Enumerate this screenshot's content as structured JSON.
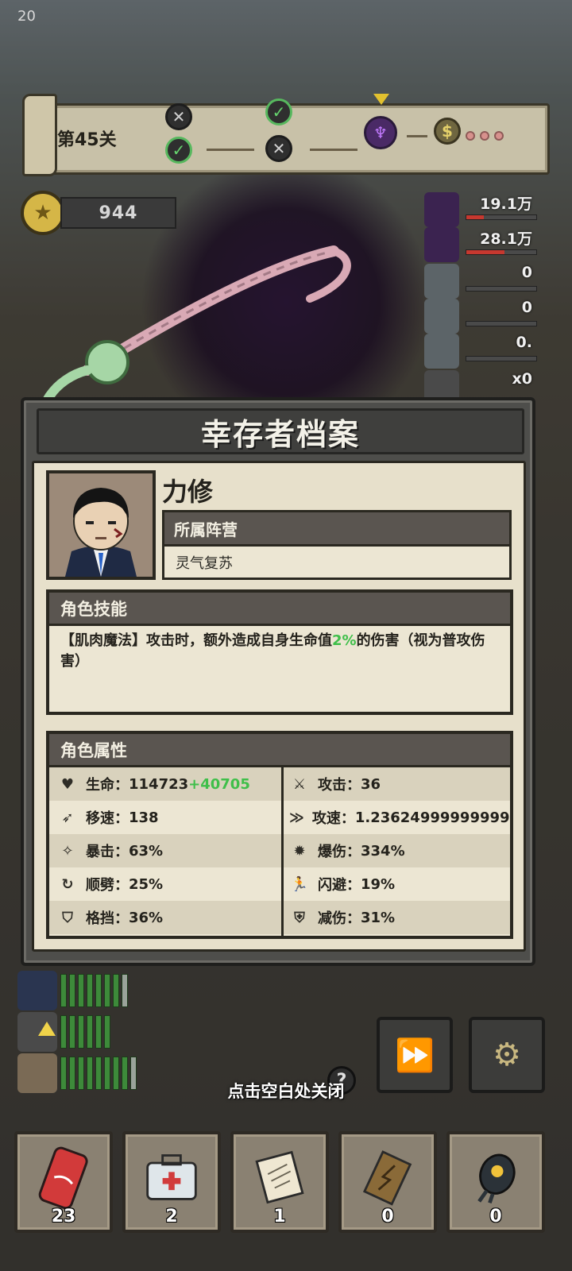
{
  "status": {
    "corner_number": "20"
  },
  "level": {
    "label": "第45关",
    "nodes": [
      {
        "icon": "crossed-swords-icon",
        "state": "done"
      },
      {
        "icon": "check-icon",
        "state": "done"
      },
      {
        "icon": "crossed-swords-icon",
        "state": "current"
      },
      {
        "icon": "check-icon",
        "state": "done"
      },
      {
        "icon": "boss-helmet-icon",
        "state": "boss"
      },
      {
        "icon": "treasure-bag-icon",
        "state": "reward"
      }
    ]
  },
  "currency": {
    "icon": "coin-icon",
    "value": "944"
  },
  "enemies": [
    {
      "value": "19.1万",
      "hp": 0.25
    },
    {
      "value": "28.1万",
      "hp": 0.55
    },
    {
      "value": "0",
      "hp": 0
    },
    {
      "value": "0",
      "hp": 0
    },
    {
      "value": "0.",
      "hp": 0
    },
    {
      "value": "x0",
      "hp": 0
    }
  ],
  "panel": {
    "title": "幸存者档案",
    "name": "力修",
    "faction_label": "所属阵营",
    "faction_value": "灵气复苏",
    "skill_label": "角色技能",
    "skill_text_pre": "【肌肉魔法】攻击时，额外造成自身生命值",
    "skill_text_hl": "2%",
    "skill_text_post": "的伤害（视为普攻伤害）",
    "attr_label": "角色属性",
    "attributes": {
      "hp": {
        "label": "生命：",
        "value": "114723",
        "bonus": "+40705",
        "icon": "heart-icon"
      },
      "atk": {
        "label": "攻击：",
        "value": "36",
        "icon": "sword-icon"
      },
      "move_speed": {
        "label": "移速：",
        "value": "138",
        "icon": "boot-icon"
      },
      "atk_speed": {
        "label": "攻速：",
        "value": "1.2362499999999998",
        "icon": "speed-icon"
      },
      "crit": {
        "label": "暴击：",
        "value": "63%",
        "icon": "crit-icon"
      },
      "crit_dmg": {
        "label": "爆伤：",
        "value": "334%",
        "icon": "burst-icon"
      },
      "pierce": {
        "label": "顺劈：",
        "value": "25%",
        "icon": "cleave-icon"
      },
      "dodge": {
        "label": "闪避：",
        "value": "19%",
        "icon": "running-man-icon"
      },
      "block": {
        "label": "格挡：",
        "value": "36%",
        "icon": "shield-icon"
      },
      "dmg_reduce": {
        "label": "减伤：",
        "value": "31%",
        "icon": "armor-icon"
      }
    }
  },
  "team": [
    {
      "name": "leader",
      "bars_full": 7,
      "bars_total": 8
    },
    {
      "name": "second",
      "bars_full": 6,
      "bars_total": 6
    },
    {
      "name": "third",
      "bars_full": 8,
      "bars_total": 9
    }
  ],
  "controls": {
    "fast_forward_icon": "fast-forward-icon",
    "settings_icon": "gear-icon",
    "help_label": "?"
  },
  "close_hint": "点击空白处关闭",
  "items": [
    {
      "icon": "cola-can-icon",
      "count": "23"
    },
    {
      "icon": "medkit-icon",
      "count": "2"
    },
    {
      "icon": "scroll-icon",
      "count": "1"
    },
    {
      "icon": "lightning-board-icon",
      "count": "0"
    },
    {
      "icon": "nuke-bomb-icon",
      "count": "0"
    }
  ],
  "colors": {
    "accent_green": "#3fbf4a",
    "hp_red": "#c6382f",
    "panel_paper": "#e7e0cb"
  }
}
